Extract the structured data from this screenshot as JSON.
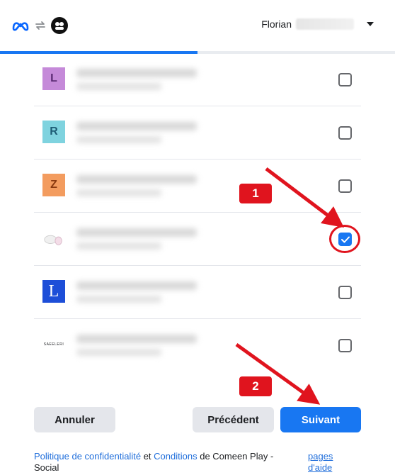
{
  "header": {
    "user_name": "Florian"
  },
  "progress": {
    "fraction": 0.5
  },
  "rows": [
    {
      "avatar_letter": "L",
      "avatar_bg": "#c58ad9",
      "avatar_fg": "#5a2a73",
      "checked": false
    },
    {
      "avatar_letter": "R",
      "avatar_bg": "#7fd3df",
      "avatar_fg": "#1e5c75",
      "checked": false
    },
    {
      "avatar_letter": "Z",
      "avatar_bg": "#f39c5f",
      "avatar_fg": "#8a3a10",
      "checked": false
    },
    {
      "avatar_letter": "",
      "avatar_icon": "cotton-thread-image",
      "checked": true
    },
    {
      "avatar_letter": "L",
      "avatar_bg": "#1d4ed8",
      "avatar_fg": "#ffffff",
      "checked": false
    },
    {
      "avatar_letter": "",
      "avatar_icon": "text-logo-image",
      "avatar_text": "SAEELERI",
      "checked": false
    }
  ],
  "annotations": {
    "badge_1": "1",
    "badge_2": "2",
    "color": "#e0141e"
  },
  "buttons": {
    "cancel": "Annuler",
    "previous": "Précédent",
    "next": "Suivant"
  },
  "footer": {
    "privacy_link": "Politique de confidentialité",
    "and": "et",
    "conditions_link": "Conditions",
    "suffix": "de Comeen Play - Social",
    "help_link": "pages d'aide"
  },
  "colors": {
    "accent": "#1877f2"
  }
}
